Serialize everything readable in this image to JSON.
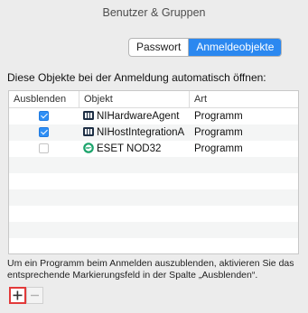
{
  "window": {
    "title": "Benutzer & Gruppen"
  },
  "tabs": [
    {
      "label": "Passwort",
      "active": false
    },
    {
      "label": "Anmeldeobjekte",
      "active": true
    }
  ],
  "heading": "Diese Objekte bei der Anmeldung automatisch öffnen:",
  "table": {
    "columns": [
      "Ausblenden",
      "Objekt",
      "Art"
    ],
    "rows": [
      {
        "hide": true,
        "icon": "ni-app-icon",
        "name": "NIHardwareAgent",
        "type": "Programm"
      },
      {
        "hide": true,
        "icon": "ni-app-icon",
        "name": "NIHostIntegrationA",
        "type": "Programm"
      },
      {
        "hide": false,
        "icon": "eset-app-icon",
        "name": "ESET NOD32",
        "type": "Programm"
      }
    ]
  },
  "hint": "Um ein Programm beim Anmelden auszublenden, aktivieren Sie das entsprechende Markierungsfeld in der Spalte „Ausblenden“.",
  "buttons": {
    "add": "+",
    "remove": "−"
  },
  "colors": {
    "accent": "#2b88f0",
    "highlight": "#e23a3a"
  }
}
